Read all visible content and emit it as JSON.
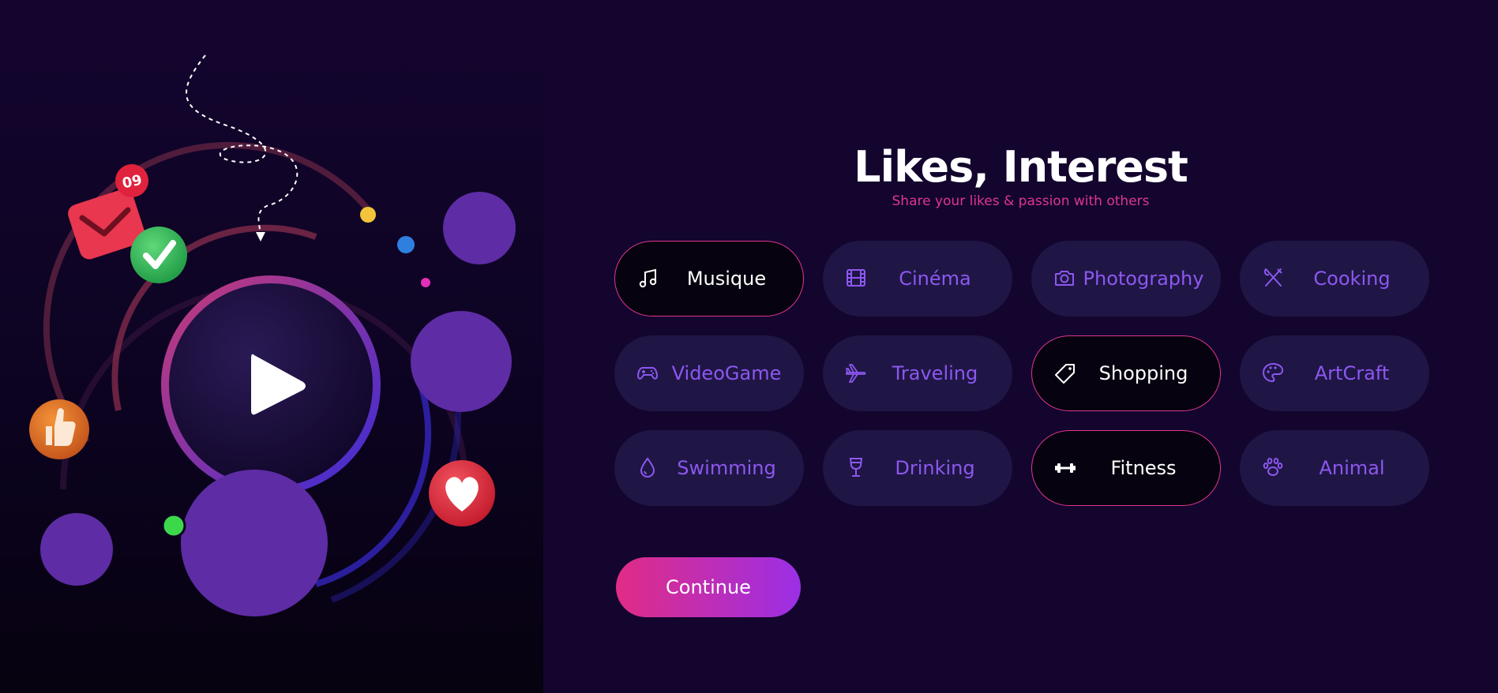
{
  "colors": {
    "background": "#13052e",
    "chip_bg": "#1f1645",
    "chip_selected_bg": "#06020f",
    "accent_pink": "#e0358f",
    "accent_purple": "#8d57f0",
    "blob_purple": "#5e2ca5"
  },
  "hero": {
    "notification_count": "09",
    "icons": [
      "mail-icon",
      "check-icon",
      "play-icon",
      "thumbs-up-icon",
      "heart-icon"
    ]
  },
  "header": {
    "title": "Likes, Interest",
    "subtitle": "Share your likes & passion with others"
  },
  "interests": [
    {
      "label": "Musique",
      "icon": "music-note-icon",
      "selected": true
    },
    {
      "label": "Cinéma",
      "icon": "film-icon",
      "selected": false
    },
    {
      "label": "Photography",
      "icon": "camera-icon",
      "selected": false
    },
    {
      "label": "Cooking",
      "icon": "utensils-icon",
      "selected": false
    },
    {
      "label": "VideoGame",
      "icon": "gamepad-icon",
      "selected": false
    },
    {
      "label": "Traveling",
      "icon": "airplane-icon",
      "selected": false
    },
    {
      "label": "Shopping",
      "icon": "tag-icon",
      "selected": true
    },
    {
      "label": "ArtCraft",
      "icon": "palette-icon",
      "selected": false
    },
    {
      "label": "Swimming",
      "icon": "droplet-icon",
      "selected": false
    },
    {
      "label": "Drinking",
      "icon": "glass-icon",
      "selected": false
    },
    {
      "label": "Fitness",
      "icon": "dumbbell-icon",
      "selected": true
    },
    {
      "label": "Animal",
      "icon": "paw-icon",
      "selected": false
    }
  ],
  "continue_label": "Continue"
}
